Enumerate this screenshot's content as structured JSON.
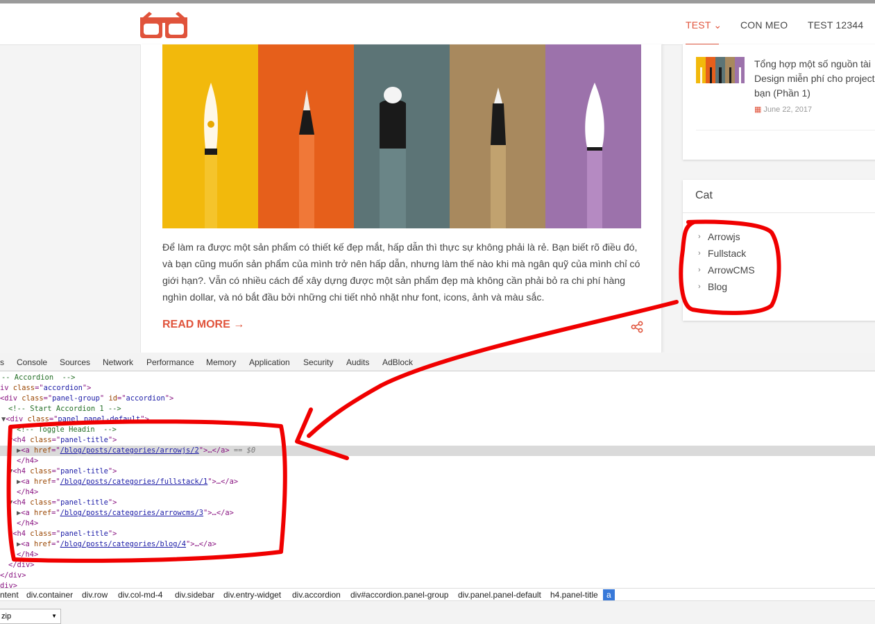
{
  "nav": {
    "items": [
      {
        "label": "TEST",
        "active": true
      },
      {
        "label": "CON MEO",
        "active": false
      },
      {
        "label": "TEST 12344",
        "active": false
      }
    ],
    "dropdown_glyph": "⌄",
    "accent_color": "#e0533b"
  },
  "post": {
    "body": "Để làm ra được một sản phẩm có thiết kế đẹp mắt, hấp dẫn thì thực sự không phải là rẻ. Bạn biết rõ điều đó, và bạn cũng muốn sản phẩm của mình trở nên hấp dẫn, nhưng làm thế nào khi mà ngân quỹ của mình chỉ có giới hạn?. Vẫn có nhiều cách để xây dựng được một sản phẩm đẹp mà không cần phải bỏ ra chi phí hàng nghìn dollar, và nó bắt đầu bởi những chi tiết nhỏ nhặt như font, icons, ảnh và màu sắc.",
    "read_more": "READ MORE",
    "hero_colors": [
      "#f2b90c",
      "#e65f1b",
      "#5c7476",
      "#a8895e",
      "#9c72ab"
    ]
  },
  "recent": {
    "title": "Tổng hợp một số nguồn tài Design miễn phí cho project bạn (Phần 1)",
    "date": "June 22, 2017"
  },
  "cat_widget": {
    "title": "Cat",
    "items": [
      "Arrowjs",
      "Fullstack",
      "ArrowCMS",
      "Blog"
    ]
  },
  "devtools": {
    "tabs": [
      "s",
      "Console",
      "Sources",
      "Network",
      "Performance",
      "Memory",
      "Application",
      "Security",
      "Audits",
      "AdBlock"
    ],
    "breadcrumbs": [
      "ntent",
      "div.container",
      "div.row",
      "div.col-md-4",
      "div.sidebar",
      "div.entry-widget",
      "div.accordion",
      "div#accordion.panel-group",
      "div.panel.panel-default",
      "h4.panel-title",
      "a"
    ],
    "select_value": "zip",
    "code": {
      "l0": "-- Accordion  -->",
      "l1a": "iv ",
      "l1b": "class",
      "l1c": "accordion",
      "l2a": "div ",
      "l2b": "class",
      "l2c": "panel-group",
      "l2d": "id",
      "l2e": "accordion",
      "l3": "<!-- Start Accordion 1 -->",
      "l4a": "<div ",
      "l4b": "class",
      "l4c": "panel panel-default",
      "l5": "<!-- Toggle Headin  -->",
      "h4tag": "<h4 ",
      "h4class": "class",
      "h4val": "panel-title",
      "h4close": "</h4>",
      "atag": "<a ",
      "ahref": "href",
      "aclose": "</a>",
      "href1": "/blog/posts/categories/arrowjs/2",
      "href2": "/blog/posts/categories/fullstack/1",
      "href3": "/blog/posts/categories/arrowcms/3",
      "href4": "/blog/posts/categories/blog/4",
      "eq": "== $0",
      "divclose": "</div>",
      "divclose2": "/div>",
      "divclose3": "div>"
    }
  }
}
